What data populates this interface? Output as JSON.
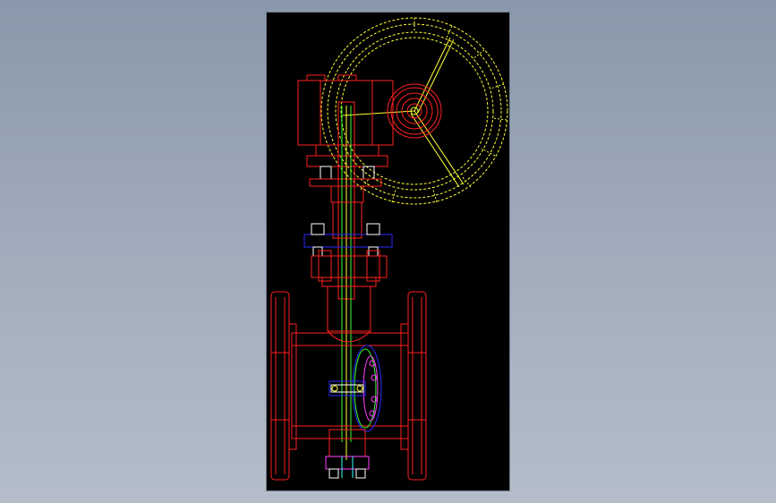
{
  "colors": {
    "background_top": "#8a98ab",
    "background_bottom": "#b4bdc9",
    "canvas": "#000000",
    "red": "#ff2020",
    "yellow": "#ffff33",
    "green": "#33ff33",
    "blue": "#2a2aff",
    "magenta": "#ff40ff",
    "cyan": "#33ffff",
    "white": "#ffffff"
  },
  "drawing": {
    "subject": "gear-operated-valve-assembly",
    "parts": [
      "handwheel",
      "gearbox",
      "stem",
      "bonnet-flange",
      "valve-body",
      "end-flanges",
      "bottom-cap"
    ]
  }
}
